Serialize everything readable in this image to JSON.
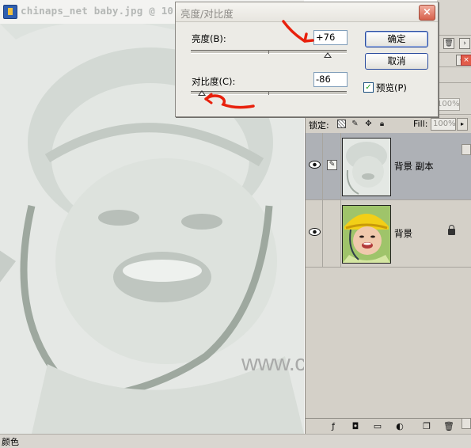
{
  "document": {
    "title": "chinaps_net baby.jpg @ 10",
    "watermark": "www.chinaps.net"
  },
  "status_bar": {
    "text": "颜色"
  },
  "dialog": {
    "title": "亮度/对比度",
    "brightness": {
      "label": "亮度(B):",
      "value": "+76",
      "slider_fraction": 0.88
    },
    "contrast": {
      "label": "对比度(C):",
      "value": "-86",
      "slider_fraction": 0.07
    },
    "ok_label": "确定",
    "cancel_label": "取消",
    "preview_label": "预览(P)",
    "preview_checked": true
  },
  "side_panels": {
    "opacity_value": "100%"
  },
  "layers_panel": {
    "lock_label": "锁定:",
    "fill_label": "Fill:",
    "fill_value": "100%",
    "layers": [
      {
        "name": "背景 副本",
        "selected": true,
        "visible": true
      },
      {
        "name": "背景",
        "selected": false,
        "visible": true,
        "locked": true
      }
    ]
  },
  "colors": {
    "selection": "#aeb1b6",
    "panel": "#d4d0c8",
    "annotation_arrow": "#e8200c"
  }
}
